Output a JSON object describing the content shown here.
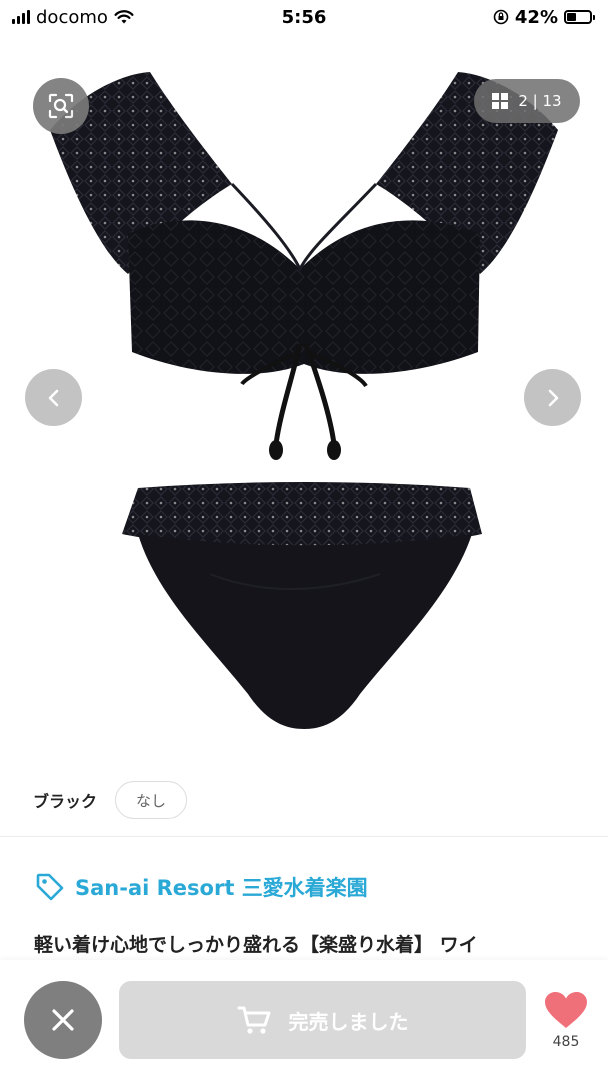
{
  "status_bar": {
    "carrier": "docomo",
    "time": "5:56",
    "battery": "42%"
  },
  "carousel": {
    "counter": "2 | 13",
    "icons": {
      "zoom": "search-zoom-icon",
      "grid": "grid-icon",
      "prev": "chevron-left-icon",
      "next": "chevron-right-icon"
    }
  },
  "variant": {
    "label": "ブラック",
    "chip": "なし"
  },
  "shop": {
    "name": "San-ai Resort 三愛水着楽園",
    "icon": "tag-icon",
    "color": "#2aa9d6"
  },
  "product": {
    "title": "軽い着け心地でしっかり盛れる【楽盛り水着】 ワイ"
  },
  "actions": {
    "soldout_label": "完売しました",
    "like_count": "485",
    "like_color": "#f0707a"
  }
}
